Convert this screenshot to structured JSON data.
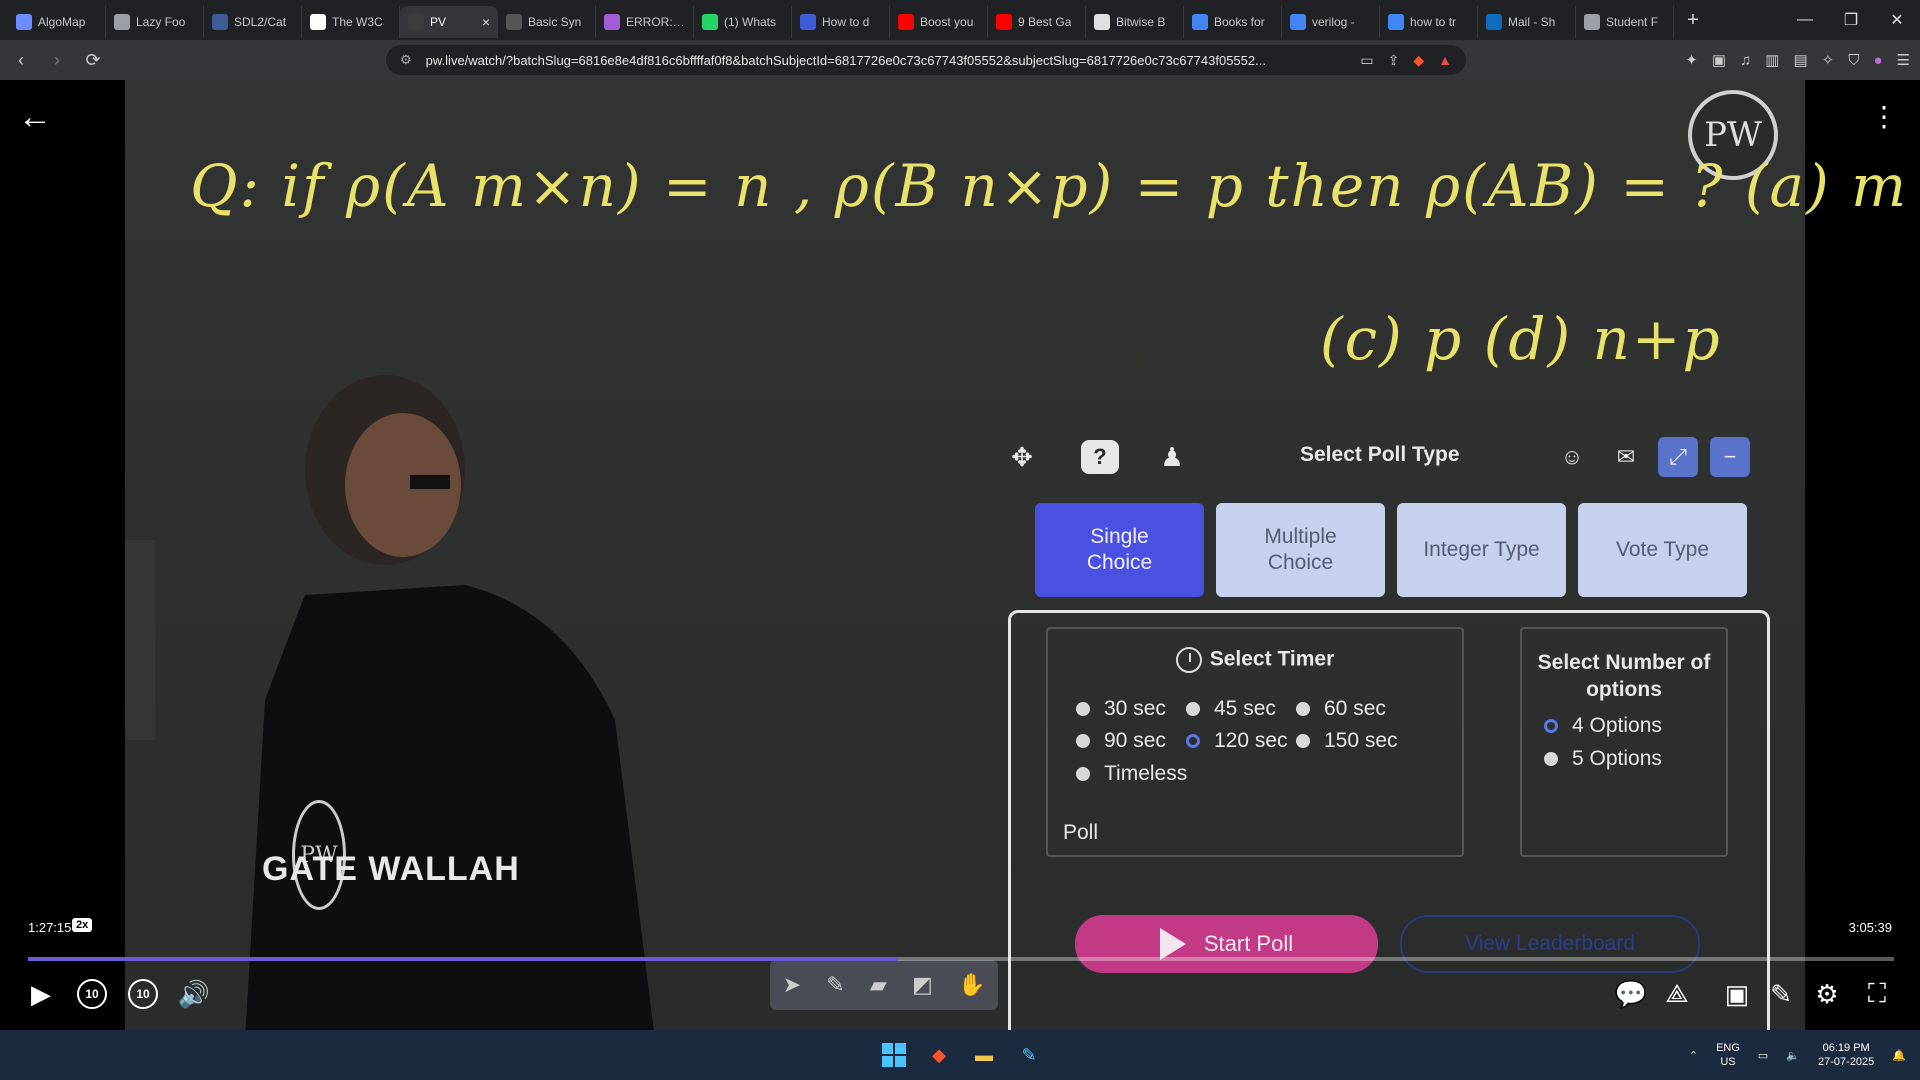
{
  "browser": {
    "tabs": [
      {
        "label": "AlgoMap",
        "icon_color": "#6c8cff",
        "active": false
      },
      {
        "label": "Lazy Foo",
        "icon_color": "#9aa0a6",
        "active": false
      },
      {
        "label": "SDL2/Cat",
        "icon_color": "#3d5a99",
        "active": false
      },
      {
        "label": "The W3C",
        "icon_color": "#ffffff",
        "active": false
      },
      {
        "label": "PV",
        "icon_color": "#3c3c3c",
        "active": true
      },
      {
        "label": "Basic Syn",
        "icon_color": "#555555",
        "active": false
      },
      {
        "label": "ERROR: Tl",
        "icon_color": "#a35bd6",
        "active": false
      },
      {
        "label": "(1) Whats",
        "icon_color": "#25d366",
        "active": false
      },
      {
        "label": "How to d",
        "icon_color": "#3f5bd6",
        "active": false
      },
      {
        "label": "Boost you",
        "icon_color": "#ff0000",
        "active": false
      },
      {
        "label": "9 Best Ga",
        "icon_color": "#ff0000",
        "active": false
      },
      {
        "label": "Bitwise B",
        "icon_color": "#e0e0e0",
        "active": false
      },
      {
        "label": "Books for",
        "icon_color": "#4285f4",
        "active": false
      },
      {
        "label": "verilog -",
        "icon_color": "#4285f4",
        "active": false
      },
      {
        "label": "how to tr",
        "icon_color": "#4285f4",
        "active": false
      },
      {
        "label": "Mail - Sh",
        "icon_color": "#0f6cbd",
        "active": false
      },
      {
        "label": "Student F",
        "icon_color": "#9aa0a6",
        "active": false
      }
    ],
    "url": "pw.live/watch/?batchSlug=6816e8e4df816c6bffffaf0f8&batchSubjectId=6817726e0c73c67743f05552&subjectSlug=6817726e0c73c67743f05552..."
  },
  "board": {
    "line1": "Q: if ρ(A m×n) = n , ρ(B n×p) = p then ρ(AB) = ?   (a) m   (b) n",
    "line2": "(c) p   (d) n+p",
    "shirt_text": "GATE WALLAH",
    "logo_text": "PW"
  },
  "poll": {
    "title": "Select Poll Type",
    "types": [
      {
        "label": "Single Choice",
        "selected": true
      },
      {
        "label": "Multiple Choice",
        "selected": false
      },
      {
        "label": "Integer Type",
        "selected": false
      },
      {
        "label": "Vote Type",
        "selected": false
      }
    ],
    "timer_title": "Select Timer",
    "timers": [
      {
        "label": "30 sec",
        "selected": false
      },
      {
        "label": "45 sec",
        "selected": false
      },
      {
        "label": "60 sec",
        "selected": false
      },
      {
        "label": "90 sec",
        "selected": false
      },
      {
        "label": "120 sec",
        "selected": true
      },
      {
        "label": "150 sec",
        "selected": false
      },
      {
        "label": "Timeless",
        "selected": false
      }
    ],
    "timeless_suffix": "Poll",
    "options_title": "Select Number of options",
    "options": [
      {
        "label": "4 Options",
        "selected": true
      },
      {
        "label": "5 Options",
        "selected": false
      }
    ],
    "start_label": "Start Poll",
    "leaderboard_label": "View Leaderboard"
  },
  "player": {
    "current_time": "1:27:15",
    "speed": "2x",
    "total_time": "3:05:39",
    "progress": 0.466,
    "skip_seconds": "10"
  },
  "taskbar": {
    "lang_top": "ENG",
    "lang_bottom": "US",
    "time": "06:19 PM",
    "date": "27-07-2025"
  }
}
